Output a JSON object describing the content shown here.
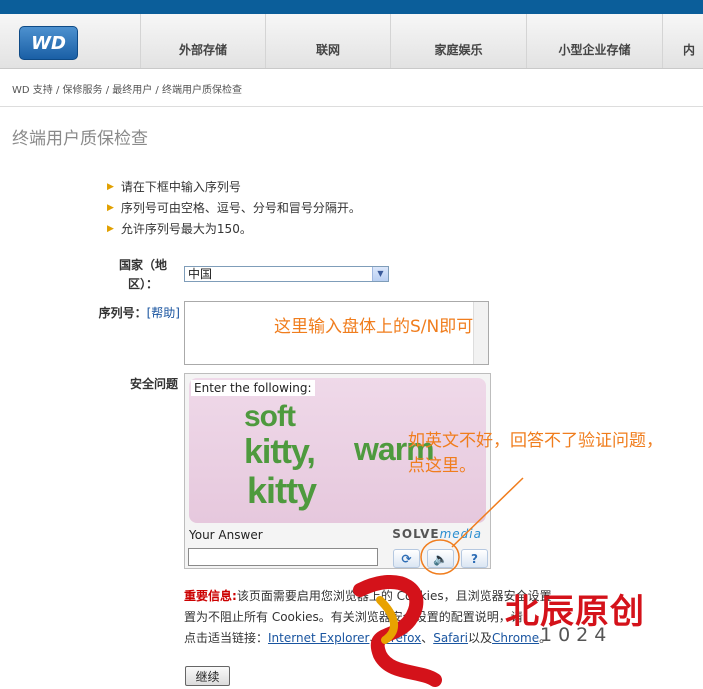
{
  "header": {
    "logo": "WD",
    "nav": [
      "外部存储",
      "联网",
      "家庭娱乐",
      "小型企业存储",
      "内"
    ]
  },
  "breadcrumb": [
    "WD 支持",
    "保修服务",
    "最终用户",
    "终端用户质保检查"
  ],
  "page_title": "终端用户质保检查",
  "instructions": [
    "请在下框中输入序列号",
    "序列号可由空格、逗号、分号和冒号分隔开。",
    "允许序列号最大为150。"
  ],
  "form": {
    "country_label_1": "国家（地",
    "country_label_2": "区）：",
    "country_value": "中国",
    "serial_label": "序列号：",
    "help_link": "[帮助]",
    "security_label": "安全问题"
  },
  "captcha": {
    "instruction": "Enter the following:",
    "words": [
      "soft",
      "kitty,",
      "warm",
      "kitty"
    ],
    "answer_label": "Your Answer",
    "brand": "SOLVE",
    "brand2": "media",
    "refresh_icon": "refresh-icon",
    "audio_icon": "speaker-icon",
    "help_icon": "question-icon"
  },
  "notice": {
    "important": "重要信息:",
    "line1": "该页面需要启用您浏览器上的 Cookies，且浏览器安全设置",
    "line2": "置为不阻止所有 Cookies。有关浏览器安全设置的配置说明，请",
    "line3": "点击适当链接：",
    "links": [
      "Internet Explorer",
      "Firefox",
      "Safari"
    ],
    "and": "以及",
    "link_last": "Chrome"
  },
  "submit_label": "继续",
  "annotations": {
    "serial_hint": "这里输入盘体上的S/N即可",
    "captcha_hint_1": "如英文不好，回答不了验证问题，",
    "captcha_hint_2": "点这里。",
    "color": "#f07d1d"
  },
  "watermark": {
    "text": "北辰原创",
    "number": "1024"
  }
}
